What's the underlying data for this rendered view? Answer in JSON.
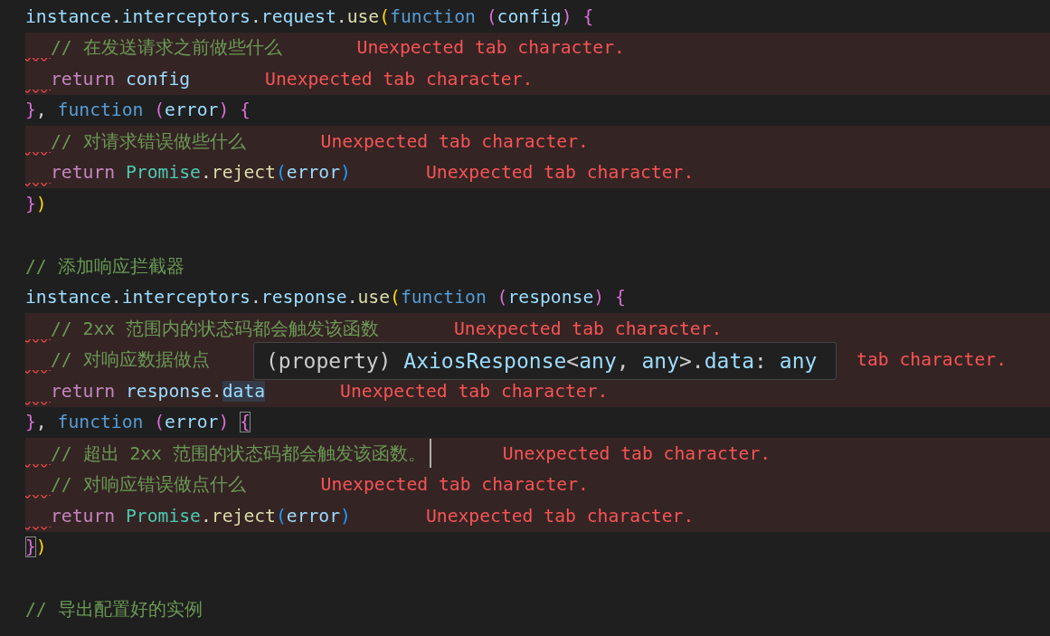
{
  "editor": {
    "lines": [
      {
        "indent": false,
        "flagged": false,
        "tokens": [
          {
            "text": "instance",
            "kind": "var"
          },
          {
            "text": ".",
            "kind": "punct"
          },
          {
            "text": "interceptors",
            "kind": "var"
          },
          {
            "text": ".",
            "kind": "punct"
          },
          {
            "text": "request",
            "kind": "var"
          },
          {
            "text": ".",
            "kind": "punct"
          },
          {
            "text": "use",
            "kind": "method"
          },
          {
            "text": "(",
            "kind": "bracket-gold"
          },
          {
            "text": "function ",
            "kind": "keyword"
          },
          {
            "text": "(",
            "kind": "bracket-pink"
          },
          {
            "text": "config",
            "kind": "var"
          },
          {
            "text": ") {",
            "kind": "bracket-pink"
          }
        ]
      },
      {
        "indent": true,
        "flagged": true,
        "tokens": [
          {
            "text": "// 在发送请求之前做些什么",
            "kind": "comment"
          }
        ],
        "error": "Unexpected tab character."
      },
      {
        "indent": true,
        "flagged": true,
        "tokens": [
          {
            "text": "return ",
            "kind": "control"
          },
          {
            "text": "config",
            "kind": "var"
          }
        ],
        "error": "Unexpected tab character."
      },
      {
        "indent": false,
        "flagged": false,
        "tokens": [
          {
            "text": "}",
            "kind": "bracket-pink"
          },
          {
            "text": ",",
            "kind": "punct"
          },
          {
            "text": " function ",
            "kind": "keyword"
          },
          {
            "text": "(",
            "kind": "bracket-pink"
          },
          {
            "text": "error",
            "kind": "var"
          },
          {
            "text": ") {",
            "kind": "bracket-pink"
          }
        ]
      },
      {
        "indent": true,
        "flagged": true,
        "tokens": [
          {
            "text": "// 对请求错误做些什么",
            "kind": "comment"
          }
        ],
        "error": "Unexpected tab character."
      },
      {
        "indent": true,
        "flagged": true,
        "tokens": [
          {
            "text": "return ",
            "kind": "control"
          },
          {
            "text": "Promise",
            "kind": "class"
          },
          {
            "text": ".",
            "kind": "punct"
          },
          {
            "text": "reject",
            "kind": "method"
          },
          {
            "text": "(",
            "kind": "bracket-blue"
          },
          {
            "text": "error",
            "kind": "var"
          },
          {
            "text": ")",
            "kind": "bracket-blue"
          }
        ],
        "error": "Unexpected tab character."
      },
      {
        "indent": false,
        "flagged": false,
        "tokens": [
          {
            "text": "}",
            "kind": "bracket-pink"
          },
          {
            "text": ")",
            "kind": "bracket-gold"
          }
        ]
      },
      {
        "indent": false,
        "flagged": false
      },
      {
        "indent": false,
        "flagged": false,
        "tokens": [
          {
            "text": "// 添加响应拦截器",
            "kind": "comment"
          }
        ]
      },
      {
        "indent": false,
        "flagged": false,
        "tokens": [
          {
            "text": "instance",
            "kind": "var"
          },
          {
            "text": ".",
            "kind": "punct"
          },
          {
            "text": "interceptors",
            "kind": "var"
          },
          {
            "text": ".",
            "kind": "punct"
          },
          {
            "text": "response",
            "kind": "var"
          },
          {
            "text": ".",
            "kind": "punct"
          },
          {
            "text": "use",
            "kind": "method"
          },
          {
            "text": "(",
            "kind": "bracket-gold"
          },
          {
            "text": "function ",
            "kind": "keyword"
          },
          {
            "text": "(",
            "kind": "bracket-pink"
          },
          {
            "text": "response",
            "kind": "var"
          },
          {
            "text": ") {",
            "kind": "bracket-pink"
          }
        ]
      },
      {
        "indent": true,
        "flagged": true,
        "tokens": [
          {
            "text": "// 2xx 范围内的状态码都会触发该函数",
            "kind": "comment"
          }
        ],
        "error": "Unexpected tab character."
      },
      {
        "indent": true,
        "flagged": true,
        "tokens": [
          {
            "text": "// 对响应数据做点",
            "kind": "comment"
          }
        ],
        "error": "tab character.",
        "error_partly_covered": true
      },
      {
        "indent": true,
        "flagged": true,
        "tokens": [
          {
            "text": "return ",
            "kind": "control"
          },
          {
            "text": "response",
            "kind": "var"
          },
          {
            "text": ".",
            "kind": "punct"
          },
          {
            "text": "data",
            "kind": "var",
            "highlighted": true
          }
        ],
        "error": "Unexpected tab character."
      },
      {
        "indent": false,
        "flagged": false,
        "tokens": [
          {
            "text": "}",
            "kind": "bracket-pink"
          },
          {
            "text": ",",
            "kind": "punct"
          },
          {
            "text": " function ",
            "kind": "keyword"
          },
          {
            "text": "(",
            "kind": "bracket-pink"
          },
          {
            "text": "error",
            "kind": "var"
          },
          {
            "text": ") ",
            "kind": "bracket-pink"
          },
          {
            "text": "{",
            "kind": "bracket-pink",
            "matched": true
          }
        ]
      },
      {
        "indent": true,
        "flagged": true,
        "cursor": true,
        "tokens": [
          {
            "text": "// 超出 2xx 范围的状态码都会触发该函数。",
            "kind": "comment"
          }
        ],
        "error": "Unexpected tab character."
      },
      {
        "indent": true,
        "flagged": true,
        "tokens": [
          {
            "text": "// 对响应错误做点什么",
            "kind": "comment"
          }
        ],
        "error": "Unexpected tab character."
      },
      {
        "indent": true,
        "flagged": true,
        "tokens": [
          {
            "text": "return ",
            "kind": "control"
          },
          {
            "text": "Promise",
            "kind": "class"
          },
          {
            "text": ".",
            "kind": "punct"
          },
          {
            "text": "reject",
            "kind": "method"
          },
          {
            "text": "(",
            "kind": "bracket-blue"
          },
          {
            "text": "error",
            "kind": "var"
          },
          {
            "text": ")",
            "kind": "bracket-blue"
          }
        ],
        "error": "Unexpected tab character."
      },
      {
        "indent": false,
        "flagged": false,
        "tokens": [
          {
            "text": "}",
            "kind": "bracket-pink",
            "matched": true
          },
          {
            "text": ")",
            "kind": "bracket-gold"
          }
        ]
      },
      {
        "indent": false,
        "flagged": false
      },
      {
        "indent": false,
        "flagged": false,
        "tokens": [
          {
            "text": "// 导出配置好的实例",
            "kind": "comment"
          }
        ]
      }
    ],
    "tooltip": {
      "tokens": [
        {
          "text": "(property) ",
          "kind": "punct"
        },
        {
          "text": "AxiosResponse",
          "kind": "var"
        },
        {
          "text": "<",
          "kind": "punct"
        },
        {
          "text": "any",
          "kind": "var"
        },
        {
          "text": ", ",
          "kind": "punct"
        },
        {
          "text": "any",
          "kind": "var"
        },
        {
          "text": ">.",
          "kind": "punct"
        },
        {
          "text": "data",
          "kind": "var"
        },
        {
          "text": ": ",
          "kind": "punct"
        },
        {
          "text": "any",
          "kind": "var"
        }
      ]
    }
  }
}
